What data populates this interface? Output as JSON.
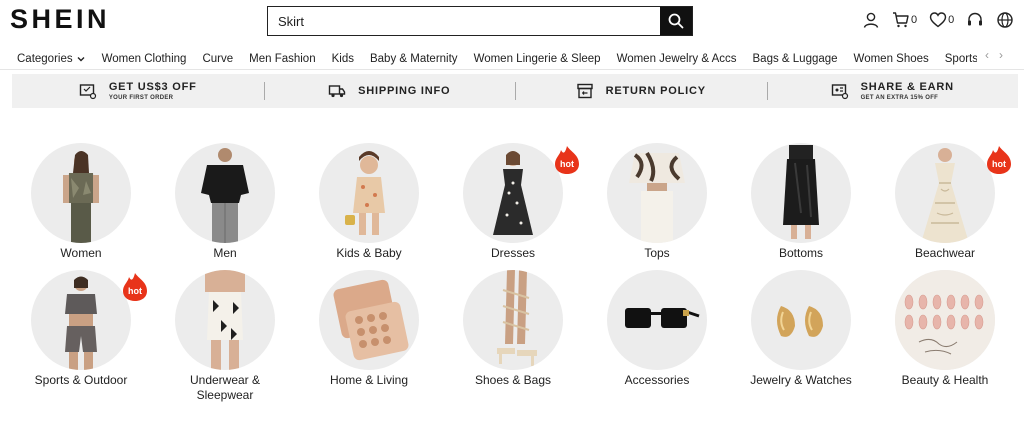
{
  "brand": {
    "logo": "SHEIN"
  },
  "search": {
    "value": "Skirt"
  },
  "header": {
    "cart_count": "0",
    "wishlist_count": "0"
  },
  "nav": {
    "items": [
      "Categories",
      "Women Clothing",
      "Curve",
      "Men Fashion",
      "Kids",
      "Baby & Maternity",
      "Women Lingerie & Sleep",
      "Women Jewelry & Accs",
      "Bags & Luggage",
      "Women Shoes",
      "Sports & Outdoor"
    ]
  },
  "promo": [
    {
      "title": "GET US$3 OFF",
      "sub": "YOUR FIRST ORDER"
    },
    {
      "title": "SHIPPING INFO",
      "sub": ""
    },
    {
      "title": "RETURN POLICY",
      "sub": ""
    },
    {
      "title": "SHARE & EARN",
      "sub": "GET AN EXTRA 15% OFF"
    }
  ],
  "categories": [
    {
      "label": "Women",
      "hot": false
    },
    {
      "label": "Men",
      "hot": false
    },
    {
      "label": "Kids & Baby",
      "hot": false
    },
    {
      "label": "Dresses",
      "hot": true
    },
    {
      "label": "Tops",
      "hot": false
    },
    {
      "label": "Bottoms",
      "hot": false
    },
    {
      "label": "Beachwear",
      "hot": true
    },
    {
      "label": "Sports & Outdoor",
      "hot": true
    },
    {
      "label": "Underwear & Sleepwear",
      "hot": false
    },
    {
      "label": "Home & Living",
      "hot": false
    },
    {
      "label": "Shoes & Bags",
      "hot": false
    },
    {
      "label": "Accessories",
      "hot": false
    },
    {
      "label": "Jewelry & Watches",
      "hot": false
    },
    {
      "label": "Beauty & Health",
      "hot": false
    }
  ],
  "hot_badge": {
    "text": "hot",
    "color": "#e8341a"
  }
}
